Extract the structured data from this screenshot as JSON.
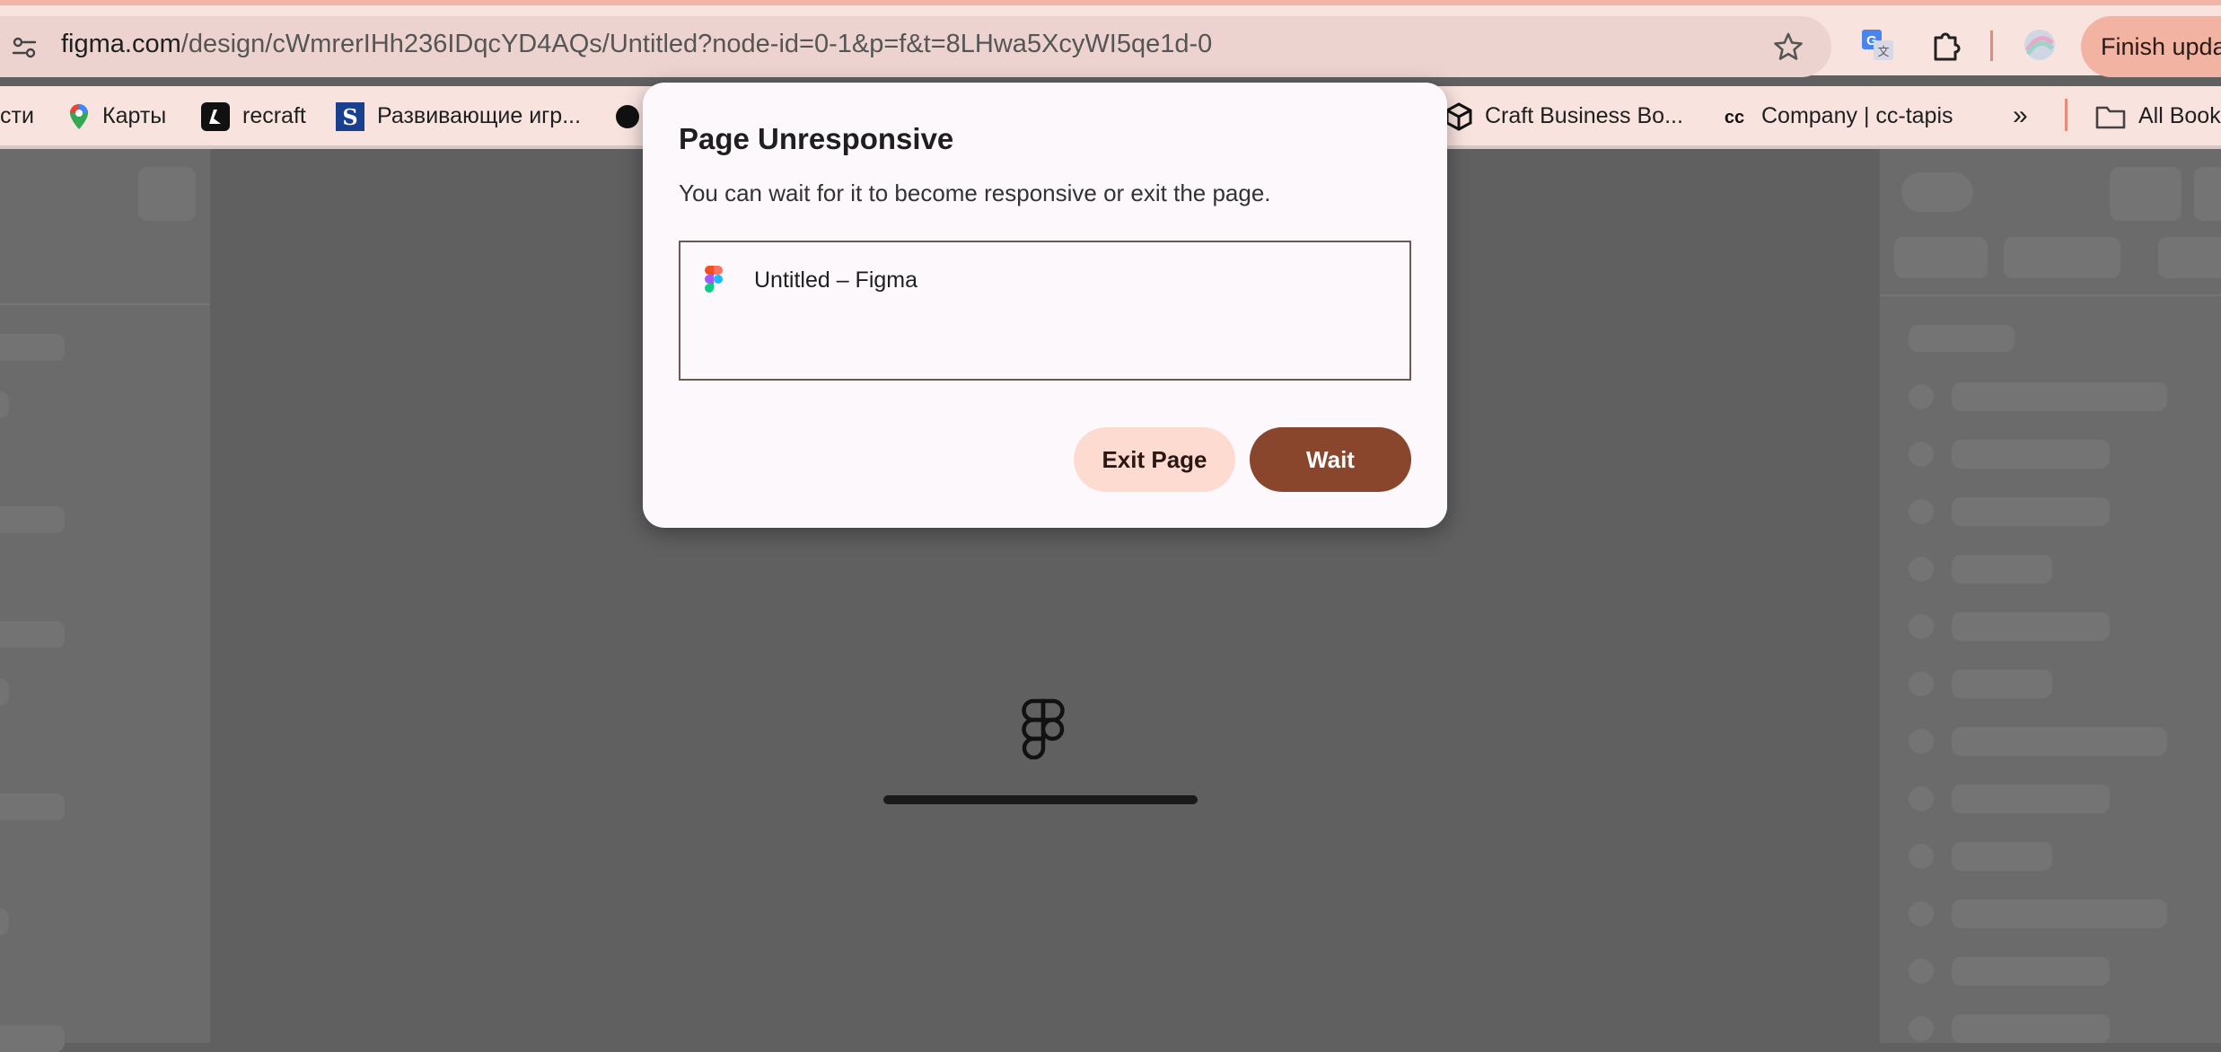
{
  "browser": {
    "url_host": "figma.com",
    "url_path": "/design/cWmrerIHh236IDqcYD4AQs/Untitled?node-id=0-1&p=f&t=8LHwa5XcyWI5qe1d-0",
    "finish_update_label": "Finish upda",
    "bookmarks": [
      {
        "label": "сти",
        "icon": "none"
      },
      {
        "label": "Карты",
        "icon": "maps-pin-icon"
      },
      {
        "label": "recraft",
        "icon": "recraft-icon"
      },
      {
        "label": "Развивающие игр...",
        "icon": "s-logo-icon"
      },
      {
        "label": "",
        "icon": "black-circle-icon"
      },
      {
        "label": "Craft Business Bo...",
        "icon": "cube-icon"
      },
      {
        "label": "Company | cc-tapis",
        "icon": "cc-icon"
      },
      {
        "label": "All Book",
        "icon": "folder-icon"
      }
    ],
    "more_bookmarks_glyph": "»"
  },
  "colors": {
    "accent": "#8a452d",
    "exit_button_bg": "#fddbd1",
    "dialog_bg": "#fdf8fb",
    "chrome_bg": "#f8e3df"
  },
  "figma": {
    "loading_progress_percent": 100
  },
  "dialog": {
    "title": "Page Unresponsive",
    "message": "You can wait for it to become responsive or exit the page.",
    "pages": [
      {
        "title": "Untitled – Figma",
        "icon": "figma-icon"
      }
    ],
    "exit_label": "Exit Page",
    "wait_label": "Wait"
  }
}
